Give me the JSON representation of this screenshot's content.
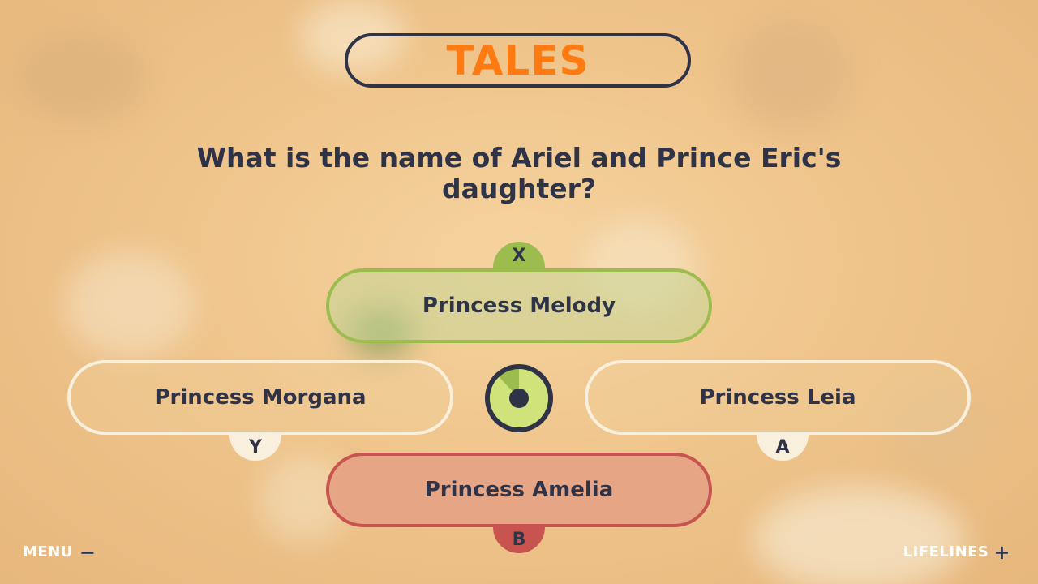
{
  "category": {
    "title": "TALES"
  },
  "question": {
    "text": "What is the name of Ariel and Prince Eric's daughter?"
  },
  "answers": [
    {
      "key": "X",
      "label": "Princess Melody"
    },
    {
      "key": "Y",
      "label": "Princess Morgana"
    },
    {
      "key": "A",
      "label": "Princess Leia"
    },
    {
      "key": "B",
      "label": "Princess Amelia"
    }
  ],
  "controls": {
    "menu_label": "MENU",
    "menu_icon": "minus-icon",
    "lifelines_label": "LIFELINES",
    "lifelines_icon": "plus-icon"
  },
  "timer": {
    "icon": "timer-dial-icon",
    "remaining_fraction": 0.88
  },
  "colors": {
    "title_accent": "#ff7a10",
    "text_dark": "#2f3347",
    "answer_x": "#9cbc4e",
    "answer_y": "#f8efdd",
    "answer_a": "#f8efdd",
    "answer_b": "#c85450",
    "timer_fill": "#cfe37a",
    "timer_empty": "#9cbc4e"
  }
}
